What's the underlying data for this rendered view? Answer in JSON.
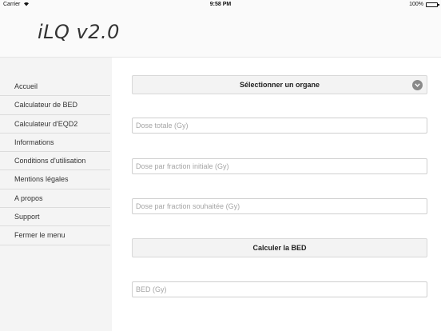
{
  "status_bar": {
    "carrier": "Carrier",
    "time": "9:58 PM",
    "battery_pct": "100%"
  },
  "header": {
    "logo": "iLQ v2.0"
  },
  "sidebar": {
    "items": [
      {
        "label": "Accueil"
      },
      {
        "label": "Calculateur de BED"
      },
      {
        "label": "Calculateur d'EQD2"
      },
      {
        "label": "Informations"
      },
      {
        "label": "Conditions d'utilisation"
      },
      {
        "label": "Mentions légales"
      },
      {
        "label": "A propos"
      },
      {
        "label": "Support"
      },
      {
        "label": "Fermer le menu"
      }
    ]
  },
  "main": {
    "organ_select_label": "Sélectionner un organe",
    "fields": {
      "total_dose": {
        "placeholder": "Dose totale (Gy)",
        "value": ""
      },
      "initial_fraction_dose": {
        "placeholder": "Dose par fraction initiale (Gy)",
        "value": ""
      },
      "desired_fraction_dose": {
        "placeholder": "Dose par fraction souhaitée (Gy)",
        "value": ""
      },
      "bed_result": {
        "placeholder": "BED (Gy)",
        "value": ""
      }
    },
    "calculate_button": "Calculer la BED"
  }
}
